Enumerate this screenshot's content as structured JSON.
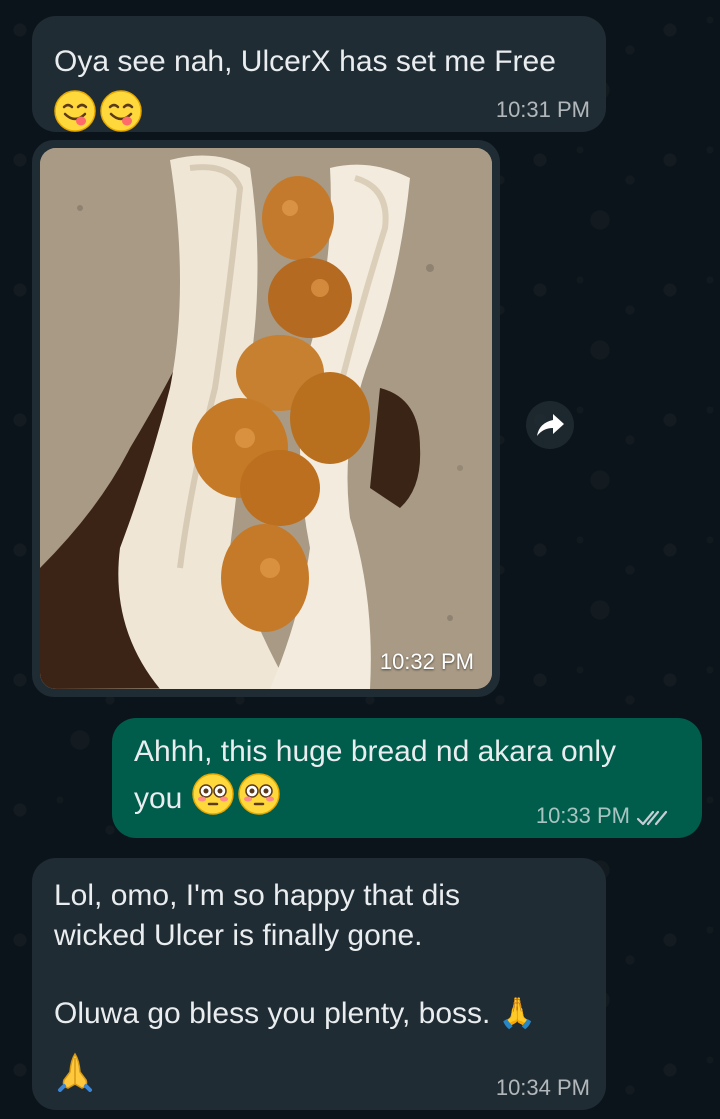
{
  "messages": [
    {
      "id": "msg-1",
      "direction": "incoming",
      "text": "Oya see nah, UlcerX has set me Free",
      "emojis": [
        "😋",
        "😋"
      ],
      "time": "10:31 PM"
    },
    {
      "id": "msg-2",
      "direction": "incoming",
      "type": "image",
      "image_alt": "Bread roll stuffed with akara",
      "time": "10:32 PM"
    },
    {
      "id": "msg-3",
      "direction": "outgoing",
      "text_line1": "Ahhh, this huge bread nd akara only",
      "text_line2": "you",
      "emojis": [
        "😳",
        "😳"
      ],
      "time": "10:33 PM",
      "status": "read"
    },
    {
      "id": "msg-4",
      "direction": "incoming",
      "text_p1": "Lol, omo, I'm so happy that dis\nwicked Ulcer is finally gone.",
      "text_p2": "Oluwa go bless you plenty, boss. 🙏",
      "emojis": [
        "🙏"
      ],
      "time": "10:34 PM"
    }
  ],
  "icons": {
    "forward": "forward-icon",
    "read_receipt": "double-check-icon"
  },
  "colors": {
    "background": "#0b141a",
    "incoming_bubble": "#202c33",
    "outgoing_bubble": "#005c4b",
    "text": "#e9edef",
    "read_tick": "#c5ced4"
  }
}
